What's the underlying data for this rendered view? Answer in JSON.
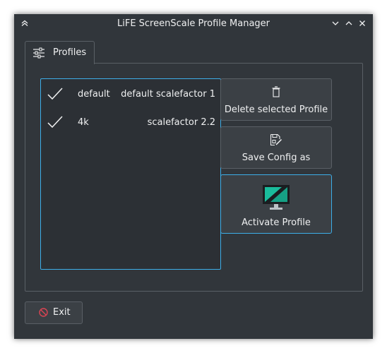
{
  "window": {
    "title": "LiFE ScreenScale Profile Manager",
    "accent_color": "#3daee9"
  },
  "titlebar": {
    "left_icon": "keep-above-icon",
    "buttons": [
      "minimize-icon",
      "maximize-icon",
      "close-icon"
    ]
  },
  "tabs": [
    {
      "label": "Profiles",
      "icon": "sliders-icon",
      "active": true
    }
  ],
  "profiles": [
    {
      "name": "default",
      "description": "default scalefactor 1",
      "icon": "checkmark-icon"
    },
    {
      "name": "4k",
      "description": "scalefactor 2.2",
      "icon": "checkmark-icon"
    }
  ],
  "actions": {
    "delete_label": "Delete selected Profile",
    "save_label": "Save Config as",
    "activate_label": "Activate Profile"
  },
  "footer": {
    "exit_label": "Exit"
  }
}
